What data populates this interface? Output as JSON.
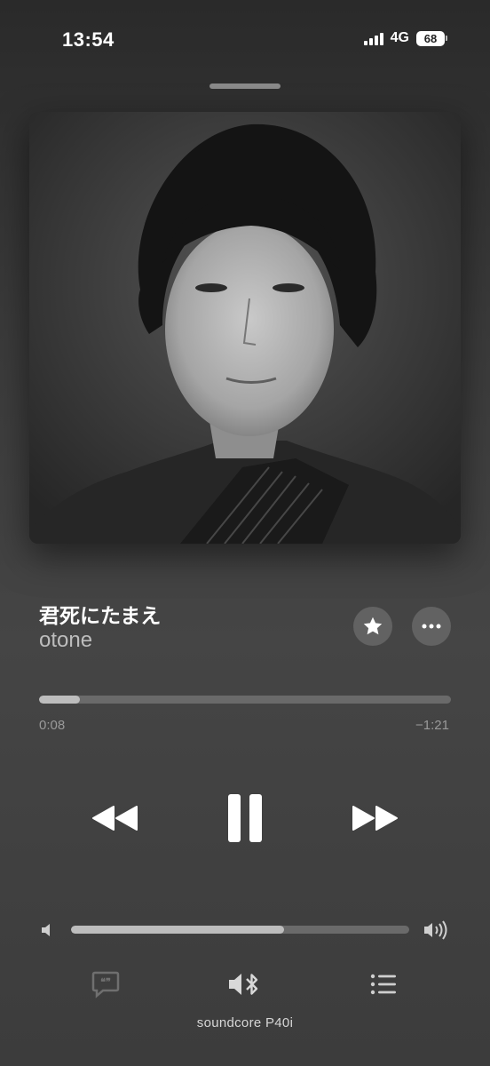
{
  "status_bar": {
    "time": "13:54",
    "network": "4G",
    "battery": "68"
  },
  "now_playing": {
    "title": "君死にたまえ",
    "artist": "otone",
    "artwork_icon": "sepia-portrait-photo"
  },
  "playback": {
    "elapsed": "0:08",
    "remaining": "−1:21",
    "progress_fraction": 0.1,
    "volume_fraction": 0.63,
    "state": "playing"
  },
  "actions": {
    "favorite_icon": "star-icon",
    "more_icon": "ellipsis-icon"
  },
  "controls": {
    "rewind_icon": "rewind-icon",
    "pause_icon": "pause-icon",
    "forward_icon": "fast-forward-icon"
  },
  "bottom_bar": {
    "lyrics_icon": "lyrics-icon",
    "output_icon": "speaker-bluetooth-icon",
    "queue_icon": "queue-list-icon",
    "device_name": "soundcore P40i"
  },
  "colors": {
    "accent_fill": "#bdbdbd",
    "track": "#6a6a6a",
    "secondary_text": "#9a9a9a"
  }
}
